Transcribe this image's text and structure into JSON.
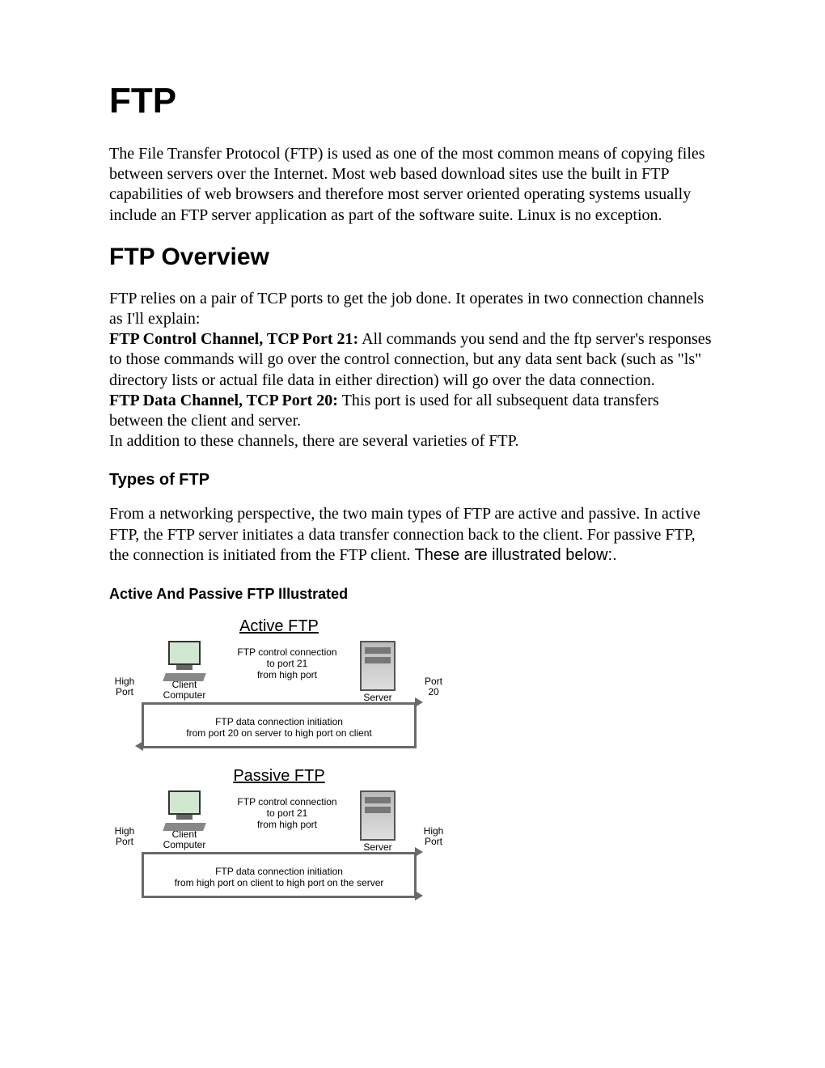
{
  "title": "FTP",
  "intro": "The File Transfer Protocol (FTP) is used as one of the most common means of copying files between servers over the Internet. Most web based download sites use the built in FTP capabilities of web browsers and therefore most server oriented operating systems usually include an FTP server application as part of the software suite. Linux is no exception.",
  "h2": "FTP Overview",
  "overview": {
    "p1": "FTP relies on a pair of TCP ports to get the job done. It operates in two connection channels as I'll explain:",
    "control_bold": "FTP Control Channel, TCP Port 21:",
    "control_text": " All commands you send and the ftp server's responses to those commands will go over the control connection, but any data sent back (such as \"ls\" directory lists or actual file data in either direction) will go over the data connection.",
    "data_bold": "FTP Data Channel, TCP Port 20:",
    "data_text": " This port is used for all subsequent data transfers between the client and server.",
    "p3": "In addition to these channels, there are several varieties of FTP."
  },
  "types": {
    "heading": "Types of FTP",
    "paragraph_serif": "From a networking perspective, the two main types of FTP are active and passive. In active FTP, the FTP server initiates a data transfer connection back to the client. For passive FTP, the connection is initiated from the FTP client. ",
    "paragraph_sans": "These are illustrated below:."
  },
  "illustrated_heading": "Active And Passive FTP Illustrated",
  "diagram": {
    "active": {
      "title": "Active FTP",
      "left_label_1": "High",
      "left_label_2": "Port",
      "client_1": "Client",
      "client_2": "Computer",
      "server": "Server",
      "right_label_1": "Port",
      "right_label_2": "20",
      "ctrl_1": "FTP control connection",
      "ctrl_2": "to port 21",
      "ctrl_3": "from high port",
      "data_1": "FTP data connection initiation",
      "data_2": "from port 20 on server to high port on client"
    },
    "passive": {
      "title": "Passive FTP",
      "left_label_1": "High",
      "left_label_2": "Port",
      "client_1": "Client",
      "client_2": "Computer",
      "server": "Server",
      "right_label_1": "High",
      "right_label_2": "Port",
      "ctrl_1": "FTP control connection",
      "ctrl_2": "to port 21",
      "ctrl_3": "from high port",
      "data_1": "FTP data connection initiation",
      "data_2": "from high port on client to high port on the server"
    }
  }
}
